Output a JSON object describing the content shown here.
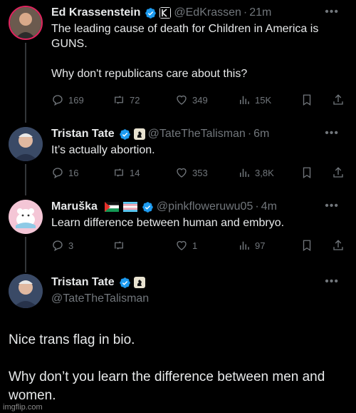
{
  "tweets": [
    {
      "name": "Ed Krassenstein",
      "handle": "@EdKrassen",
      "time": "21m",
      "lines": [
        "The leading cause of death for Children in America is GUNS.",
        "",
        "Why don't republicans care about this?"
      ],
      "stats": {
        "replies": "169",
        "retweets": "72",
        "likes": "349",
        "views": "15K"
      },
      "avatar_icon": "profile-photo-man"
    },
    {
      "name": "Tristan Tate",
      "handle": "@TateTheTalisman",
      "time": "6m",
      "lines": [
        "It’s actually abortion."
      ],
      "stats": {
        "replies": "16",
        "retweets": "14",
        "likes": "353",
        "views": "3,8K"
      },
      "avatar_icon": "profile-photo-man"
    },
    {
      "name": "Maruška",
      "handle": "@pinkfloweruwu05",
      "time": "4m",
      "lines": [
        "Learn difference between human and embryo."
      ],
      "stats": {
        "replies": "3",
        "retweets": "",
        "likes": "1",
        "views": "97"
      },
      "avatar_icon": "profile-photo-cartoon"
    }
  ],
  "main_tweet": {
    "name": "Tristan Tate",
    "handle": "@TateTheTalisman",
    "text_1": "Nice trans flag in bio.",
    "text_2": "Why don’t you learn the difference between men and women."
  },
  "watermark": "imgflip.com",
  "colors": {
    "background": "#000000",
    "text": "#e7e9ea",
    "muted": "#71767b",
    "verified": "#1d9bf0"
  }
}
